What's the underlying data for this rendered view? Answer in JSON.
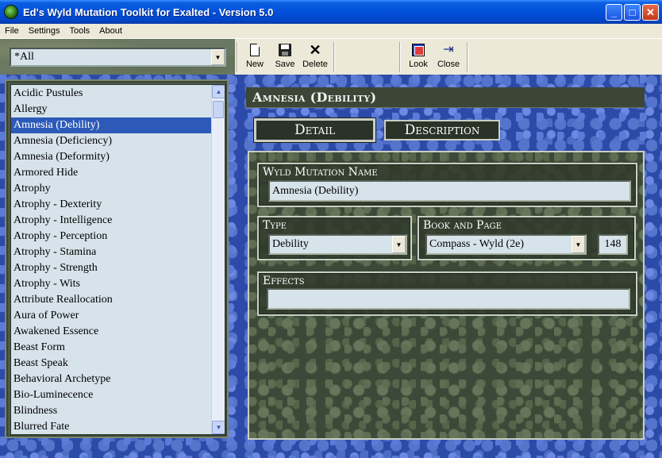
{
  "window": {
    "title": "Ed's Wyld Mutation Toolkit for Exalted - Version 5.0",
    "controls": {
      "minimize": "_",
      "maximize": "□",
      "close": "✕"
    }
  },
  "menu": [
    "File",
    "Settings",
    "Tools",
    "About"
  ],
  "filter": {
    "value": "*All"
  },
  "toolbar": {
    "new_label": "New",
    "save_label": "Save",
    "delete_label": "Delete",
    "look_label": "Look",
    "close_label": "Close"
  },
  "list": {
    "items": [
      "Acidic Pustules",
      "Allergy",
      "Amnesia (Debility)",
      "Amnesia (Deficiency)",
      "Amnesia (Deformity)",
      "Armored Hide",
      "Atrophy",
      "Atrophy - Dexterity",
      "Atrophy - Intelligence",
      "Atrophy - Perception",
      "Atrophy - Stamina",
      "Atrophy - Strength",
      "Atrophy - Wits",
      "Attribute Reallocation",
      "Aura of Power",
      "Awakened Essence",
      "Beast Form",
      "Beast Speak",
      "Behavioral Archetype",
      "Bio-Luminecence",
      "Blindness",
      "Blurred Fate"
    ],
    "selected_index": 2
  },
  "detail": {
    "header_title": "Amnesia (Debility)",
    "tabs": {
      "detail": "Detail",
      "description": "Description"
    },
    "name_group_label": "Wyld Mutation Name",
    "name_value": "Amnesia (Debility)",
    "type_group_label": "Type",
    "type_value": "Debility",
    "book_group_label": "Book and Page",
    "book_value": "Compass - Wyld (2e)",
    "page_value": "148",
    "effects_group_label": "Effects",
    "effects_value": ""
  },
  "colors": {
    "selection": "#2d5ab8",
    "field_bg": "#d7e3ea",
    "titlebar": "#0350dc"
  }
}
